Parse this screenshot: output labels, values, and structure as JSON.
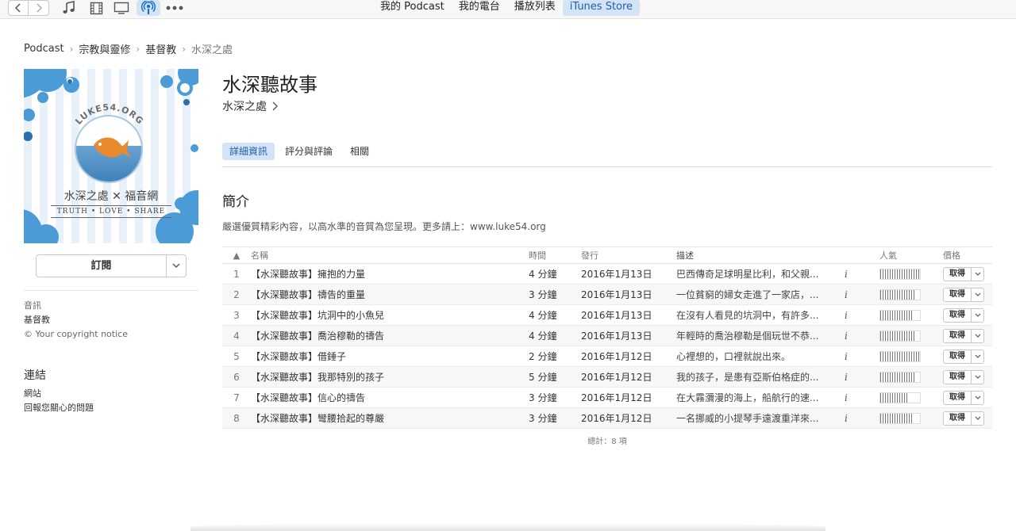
{
  "toolbar": {
    "icons": [
      "back-arrow-icon",
      "forward-arrow-icon",
      "music-note-icon",
      "film-icon",
      "tv-icon",
      "podcast-icon",
      "more-icon"
    ],
    "tabs": [
      {
        "label": "我的 Podcast"
      },
      {
        "label": "我的電台"
      },
      {
        "label": "播放列表"
      },
      {
        "label": "iTunes Store",
        "selected": true
      }
    ],
    "accent": "#d3e4f7"
  },
  "breadcrumb": [
    "Podcast",
    "宗教與靈修",
    "基督教",
    "水深之處"
  ],
  "artwork": {
    "title_text": "水深之處 ✕ 福音網",
    "tagline": "TRUTH • LOVE • SHARE",
    "logo_text": "LUKE54.ORG"
  },
  "subscribe": {
    "label": "訂閱"
  },
  "sidebar": {
    "info": {
      "type": "音訊",
      "category": "基督教",
      "copyright": "© Your copyright notice"
    },
    "links_title": "連結",
    "links": [
      "網站",
      "回報您關心的問題"
    ]
  },
  "podcast": {
    "title": "水深聽故事",
    "artist": "水深之處"
  },
  "content_tabs": [
    {
      "label": "詳細資訊",
      "selected": true
    },
    {
      "label": "評分與評論"
    },
    {
      "label": "相關"
    }
  ],
  "intro": {
    "heading": "簡介",
    "text": "嚴選優質精彩內容，以高水準的音質為您呈現。更多請上：www.luke54.org"
  },
  "table": {
    "headers": {
      "num": "▲",
      "name": "名稱",
      "time": "時間",
      "date": "發行",
      "desc": "描述",
      "popularity": "人氣",
      "price": "價格"
    },
    "rows": [
      {
        "num": "1",
        "name": "【水深聽故事】擁抱的力量",
        "time": "4 分鐘",
        "date": "2016年1月13日",
        "desc": "巴西傳奇足球明星比利，和父親...",
        "info": "i",
        "popularity": 1.0,
        "price": "取得"
      },
      {
        "num": "2",
        "name": "【水深聽故事】禱告的重量",
        "time": "3 分鐘",
        "date": "2016年1月13日",
        "desc": "一位貧窮的婦女走進了一家店，...",
        "info": "i",
        "popularity": 0.85,
        "price": "取得"
      },
      {
        "num": "3",
        "name": "【水深聽故事】坑洞中的小魚兒",
        "time": "4 分鐘",
        "date": "2016年1月13日",
        "desc": "在沒有人看見的坑洞中，有許多...",
        "info": "i",
        "popularity": 0.8,
        "price": "取得"
      },
      {
        "num": "4",
        "name": "【水深聽故事】喬治穆勒的禱告",
        "time": "4 分鐘",
        "date": "2016年1月13日",
        "desc": "年輕時的喬治穆勒是個玩世不恭...",
        "info": "i",
        "popularity": 0.85,
        "price": "取得"
      },
      {
        "num": "5",
        "name": "【水深聽故事】借錘子",
        "time": "2 分鐘",
        "date": "2016年1月12日",
        "desc": "心裡想的，口裡就說出來。",
        "info": "i",
        "popularity": 1.0,
        "price": "取得"
      },
      {
        "num": "6",
        "name": "【水深聽故事】我那特別的孩子",
        "time": "5 分鐘",
        "date": "2016年1月12日",
        "desc": "我的孩子，是患有亞斯伯格症的...",
        "info": "i",
        "popularity": 0.9,
        "price": "取得"
      },
      {
        "num": "7",
        "name": "【水深聽故事】信心的禱告",
        "time": "3 分鐘",
        "date": "2016年1月12日",
        "desc": "在大霧瀰漫的海上，船航行的速...",
        "info": "i",
        "popularity": 0.7,
        "price": "取得"
      },
      {
        "num": "8",
        "name": "【水深聽故事】彎腰拾起的尊嚴",
        "time": "3 分鐘",
        "date": "2016年1月12日",
        "desc": "一名挪威的小提琴手遠渡重洋來...",
        "info": "i",
        "popularity": 0.8,
        "price": "取得"
      }
    ],
    "total": "總計：8 項"
  }
}
